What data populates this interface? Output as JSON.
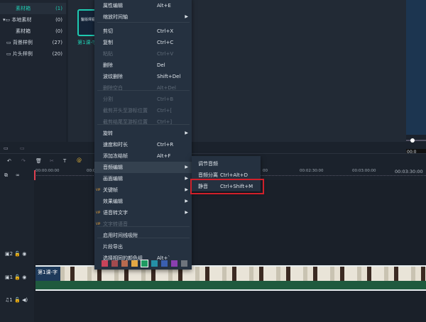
{
  "library": {
    "items": [
      {
        "label": "素材箱",
        "count": "(1)",
        "active": true
      },
      {
        "label": "本地素材",
        "count": "(0)"
      },
      {
        "label": "素材箱",
        "count": "(0)"
      },
      {
        "label": "背景样例",
        "count": "(27)"
      },
      {
        "label": "片头样例",
        "count": "(20)"
      }
    ]
  },
  "media": {
    "clip_thumb_label": "鑿版墿鏂",
    "clip_name": "第1课-字"
  },
  "timeline": {
    "ticks": [
      "00:00:00:00",
      "00:0",
      "00",
      "00:02:30:00",
      "00:03:00:00",
      "00:03:30:00"
    ],
    "preview_time": "00:0",
    "clip_title": "第1课-字"
  },
  "tracks": [
    {
      "label": "2"
    },
    {
      "label": "1"
    },
    {
      "label": "1"
    }
  ],
  "menu": {
    "items": [
      {
        "label": "属性编辑",
        "shortcut": "Alt+E"
      },
      {
        "label": "缩放时间轴",
        "submenu": true
      },
      {
        "label": "剪切",
        "shortcut": "Ctrl+X"
      },
      {
        "label": "复制",
        "shortcut": "Ctrl+C"
      },
      {
        "label": "粘贴",
        "shortcut": "Ctrl+V",
        "disabled": true
      },
      {
        "label": "删除",
        "shortcut": "Del"
      },
      {
        "label": "波纹删除",
        "shortcut": "Shift+Del"
      },
      {
        "label": "删除空白",
        "shortcut": "Alt+Del",
        "disabled": true
      },
      {
        "label": "分割",
        "shortcut": "Ctrl+B",
        "disabled": true
      },
      {
        "label": "截剪开头至游标位置",
        "shortcut": "Ctrl+[",
        "disabled": true
      },
      {
        "label": "截剪结尾至游标位置",
        "shortcut": "Ctrl+]",
        "disabled": true
      },
      {
        "label": "旋转",
        "submenu": true
      },
      {
        "label": "速度和时长",
        "shortcut": "Ctrl+R"
      },
      {
        "label": "添加冻结帧",
        "shortcut": "Alt+F"
      },
      {
        "label": "音频编辑",
        "submenu": true,
        "hover": true
      },
      {
        "label": "画面编辑",
        "submenu": true
      },
      {
        "label": "关键帧",
        "submenu": true,
        "badge": "VIP"
      },
      {
        "label": "效果编辑",
        "submenu": true
      },
      {
        "label": "语音转文字",
        "submenu": true,
        "badge": "VIP"
      },
      {
        "label": "文字转语音",
        "disabled": true,
        "badge": "VIP"
      },
      {
        "label": "启用时间线吸附"
      },
      {
        "label": "片段导出"
      },
      {
        "label": "选择相同的颜色组",
        "shortcut": "Alt+`"
      }
    ],
    "colors": [
      "#c8435a",
      "#a34a4e",
      "#b66a4f",
      "#e2a844",
      "#1f9a62",
      "#2590a6",
      "#3a5fb0",
      "#8a3fb0",
      "#6e747c"
    ],
    "submenu": [
      {
        "label": "调节音频"
      },
      {
        "label": "音频分离",
        "shortcut": "Ctrl+Alt+D"
      },
      {
        "label": "静音",
        "shortcut": "Ctrl+Shift+M"
      }
    ]
  },
  "colors": {
    "accent": "#1fc9b0",
    "highlight_box": "#d0202a",
    "audio_track": "#1f5a3e"
  }
}
